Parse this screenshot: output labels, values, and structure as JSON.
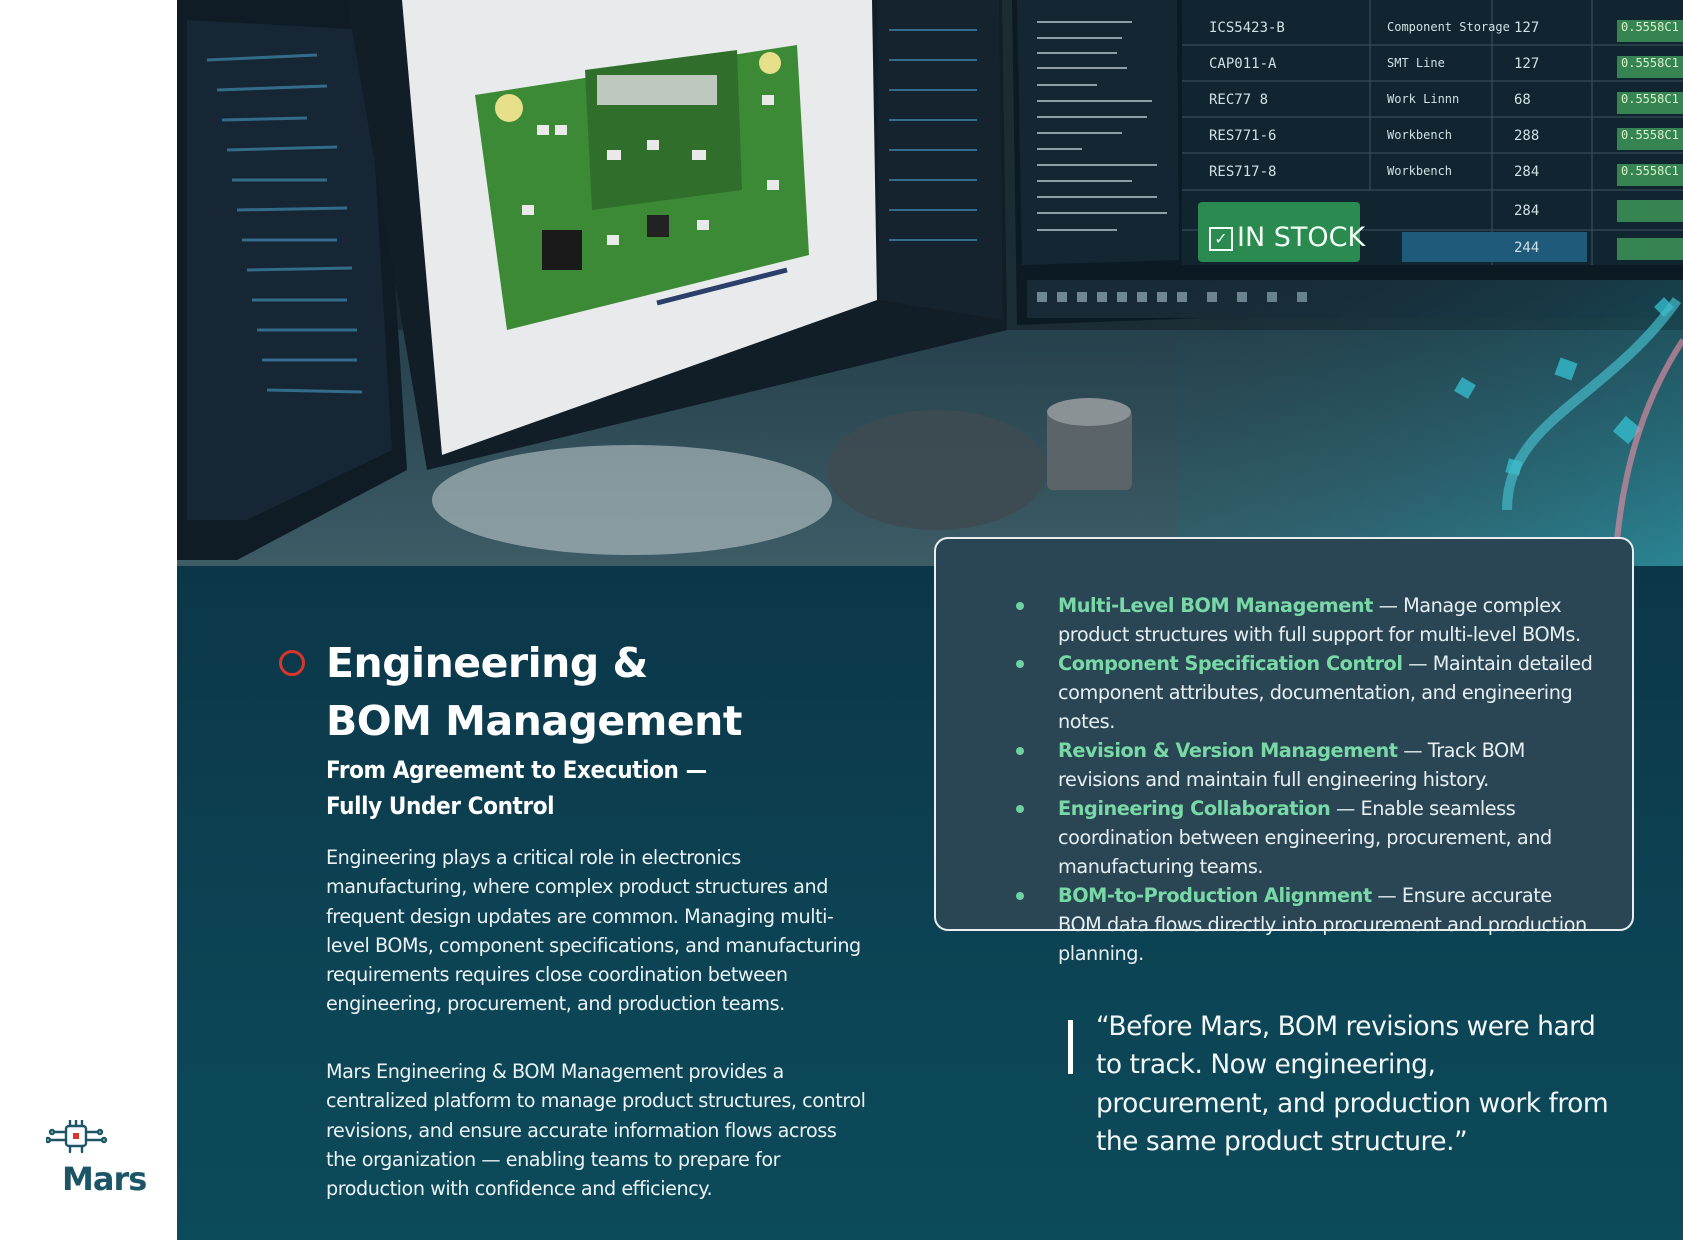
{
  "brand": {
    "name": "Mars"
  },
  "colors": {
    "accent": "#d9352b",
    "panel": "#0c4354",
    "feature_key": "#79d9a6"
  },
  "hero": {
    "table": {
      "rows": [
        [
          "ICS5423-B",
          "Component Storage",
          "127",
          "0.5558C1"
        ],
        [
          "CAP011-A",
          "SMT Line",
          "127",
          "0.5558C1"
        ],
        [
          "REC77 8",
          "Work Linnn",
          "68",
          "0.5558C1"
        ],
        [
          "RES771-6",
          "Workbench",
          "288",
          "0.5558C1"
        ],
        [
          "RES717-8",
          "Workbench",
          "284",
          "0.5558C1"
        ]
      ],
      "extra_qty": [
        "284",
        "244"
      ],
      "stock_badge": "IN STOCK"
    }
  },
  "section": {
    "title_line1": "Engineering &",
    "title_line2": "BOM Management",
    "subtitle_line1": "From Agreement to Execution —",
    "subtitle_line2": "Fully Under Control",
    "paragraph1": "Engineering plays a critical role in electronics manufacturing, where complex product structures and frequent design updates are common. Managing multi-level BOMs, component specifications, and manufacturing requirements requires close coordination between engineering, procurement, and production teams.",
    "paragraph2": "Mars Engineering & BOM Management provides a centralized platform to manage product structures, control revisions, and ensure accurate information flows across the organization — enabling teams to prepare for production with confidence and efficiency."
  },
  "features": [
    {
      "title": "Multi-Level BOM Management",
      "text": " — Manage complex product structures with full support for multi-level BOMs."
    },
    {
      "title": "Component Specification Control",
      "text": " — Maintain detailed component attributes, documentation, and engineering notes."
    },
    {
      "title": "Revision & Version Management",
      "text": " — Track BOM revisions and maintain full engineering history."
    },
    {
      "title": "Engineering Collaboration",
      "text": " — Enable seamless coordination between engineering, procurement, and manufacturing teams."
    },
    {
      "title": "BOM-to-Production Alignment",
      "text": " — Ensure accurate BOM data flows directly into procurement and production planning."
    }
  ],
  "quote": "“Before Mars, BOM revisions were hard to track. Now engineering, procurement, and production work from the same product structure.”"
}
